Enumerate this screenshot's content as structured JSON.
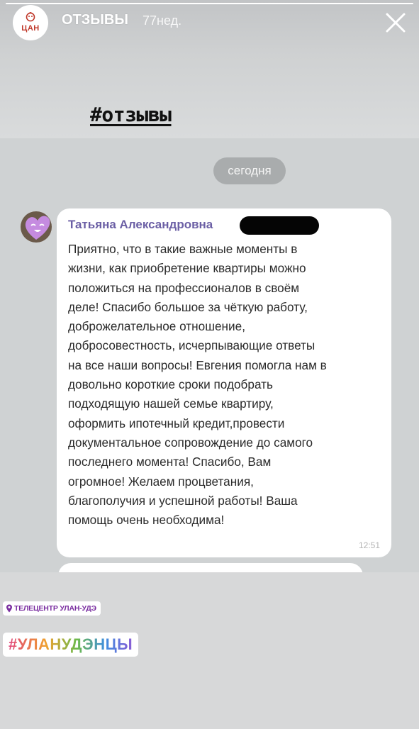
{
  "story": {
    "progress_fraction": 1.0,
    "account": {
      "logo_text": "ЦАН",
      "name": "ОТЗЫВЫ",
      "age": "77нед."
    },
    "heading": "#отзывы",
    "close_icon": "close-icon"
  },
  "chat": {
    "date_label": "сегодня",
    "message": {
      "sender": "Татьяна Александровна",
      "text": "Приятно, что в такие важные моменты в\nжизни, как приобретение квартиры можно\nположиться на профессионалов в своём\nделе! Спасибо большое за чёткую работу,\nдоброжелательное отношение,\nдобросовестность, исчерпывающие ответы\nна все наши вопросы! Евгения помогла нам в\nдовольно короткие сроки подобрать\nподходящую нашей семье квартиру,\nоформить ипотечный кредит,провести\nдокументальное сопровождение до самого\nпоследнего момента! Спасибо, Вам\nогромное! Желаем процветания,\nблагополучия и успешной работы! Ваша\nпомощь очень необходима!",
      "time": "12:51"
    }
  },
  "stickers": {
    "location": "ТЕЛЕЦЕНТР УЛАН-УДЭ",
    "hashtag": "#УЛАНУДЭНЦЫ"
  },
  "colors": {
    "sender_name": "#6b5fa5",
    "location_text": "#7a2ea0",
    "logo_red": "#c0392b",
    "avatar_heart": "#c58be0"
  }
}
